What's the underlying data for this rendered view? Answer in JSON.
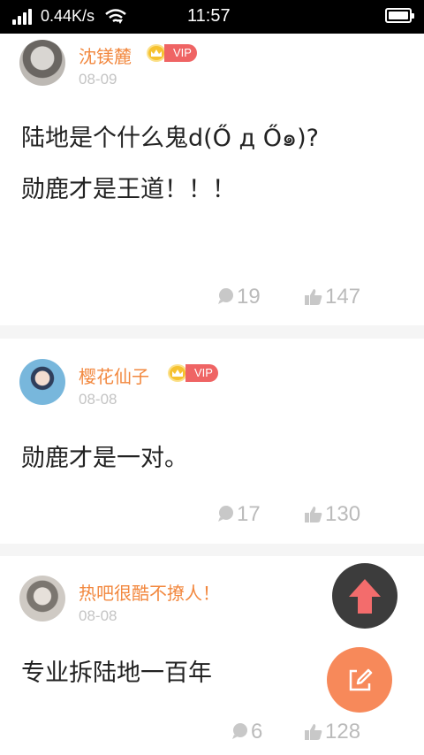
{
  "status_bar": {
    "net_speed": "0.44K/s",
    "time": "11:57"
  },
  "posts": [
    {
      "username": "沈镁麓",
      "vip_label": "VIP",
      "date": "08-09",
      "content_lines": [
        "陆地是个什么鬼d(Ő д Ő๑)?",
        "勋鹿才是王道！！！"
      ],
      "comments": "19",
      "likes": "147"
    },
    {
      "username": "樱花仙子",
      "vip_label": "VIP",
      "date": "08-08",
      "content_lines": [
        "勋鹿才是一对。"
      ],
      "comments": "17",
      "likes": "130"
    },
    {
      "username": "热吧很酷不撩人！",
      "date": "08-08",
      "content_lines": [
        "专业拆陆地一百年"
      ],
      "comments": "6",
      "likes": "128"
    }
  ],
  "colors": {
    "username": "#f2883f",
    "vip_badge": "#ef6464",
    "fab_top": "#3c3c3c",
    "fab_up_arrow": "#f36c6c",
    "fab_compose": "#f7895a"
  },
  "icons": [
    "signal-icon",
    "wifi-icon",
    "battery-icon",
    "comment-icon",
    "thumbs-up-icon",
    "arrow-up-icon",
    "edit-icon",
    "crown-icon"
  ]
}
